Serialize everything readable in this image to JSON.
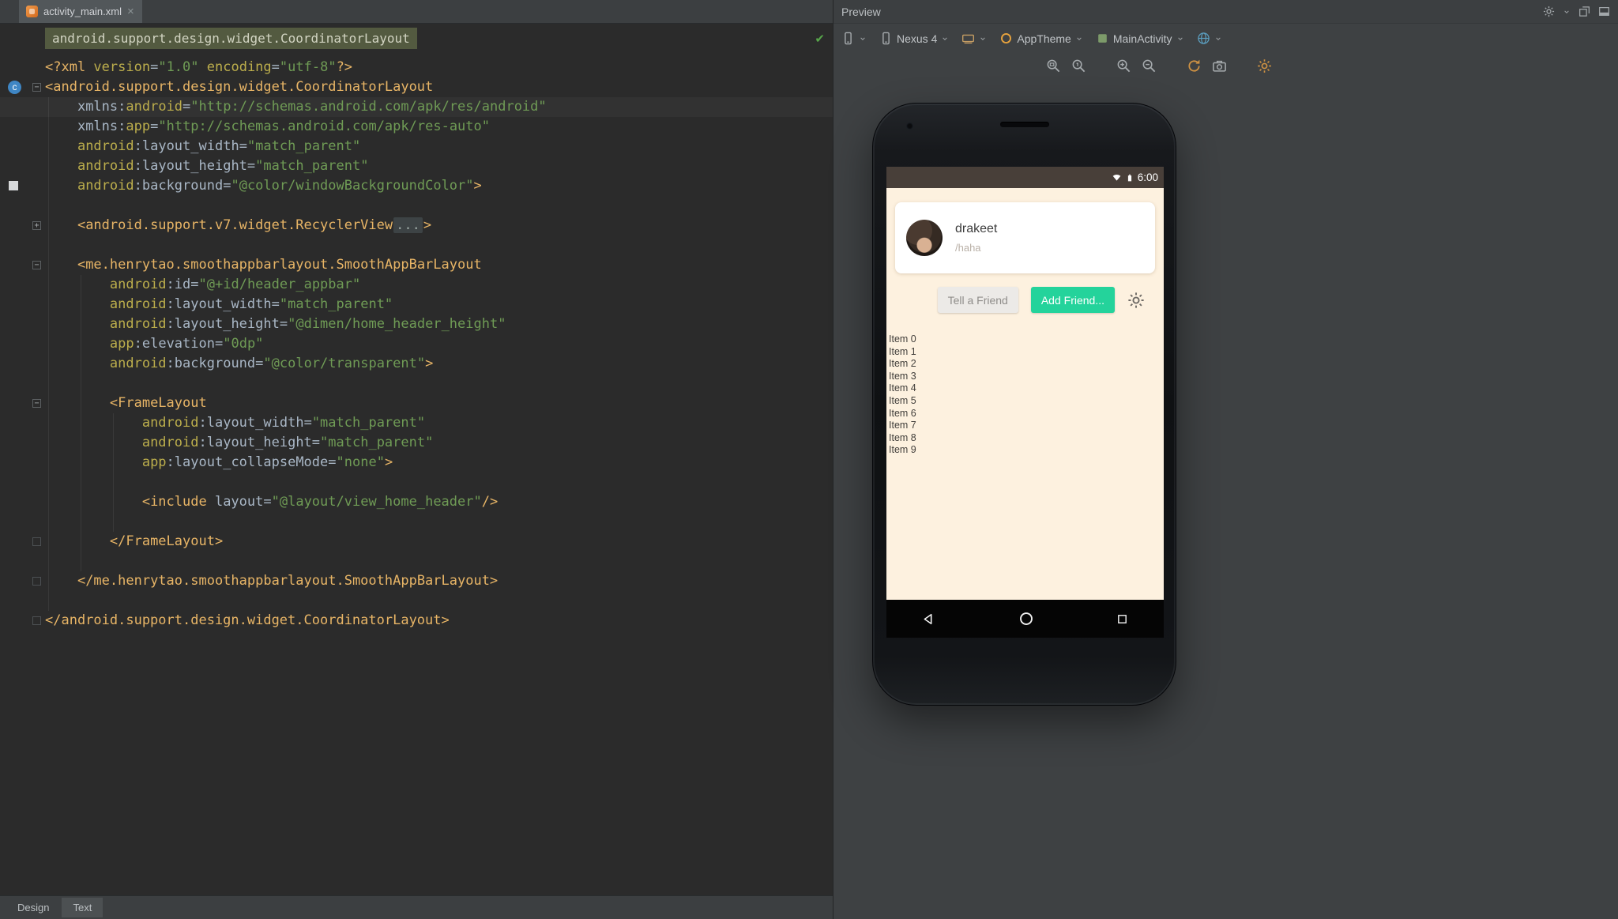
{
  "editor": {
    "tab_label": "activity_main.xml",
    "breadcrumb": "android.support.design.widget.CoordinatorLayout",
    "bottom_tabs": [
      {
        "label": "Design",
        "selected": false
      },
      {
        "label": "Text",
        "selected": true
      }
    ],
    "code_lines": [
      {
        "t": [
          [
            "g",
            "<?xml "
          ],
          [
            "a",
            "version"
          ],
          [
            "p",
            "="
          ],
          [
            "v",
            "\"1.0\""
          ],
          [
            "p",
            " "
          ],
          [
            "a",
            "encoding"
          ],
          [
            "p",
            "="
          ],
          [
            "v",
            "\"utf-8\""
          ],
          [
            "g",
            "?>"
          ]
        ]
      },
      {
        "g": "minus",
        "b": "class",
        "t": [
          [
            "g",
            "<android.support.design.widget.CoordinatorLayout"
          ]
        ]
      },
      {
        "hl": true,
        "t": [
          [
            "p",
            "    "
          ],
          [
            "n",
            "xmlns"
          ],
          [
            "p",
            ":"
          ],
          [
            "a",
            "android"
          ],
          [
            "p",
            "="
          ],
          [
            "v",
            "\"http://schemas.android.com/apk/res/android\""
          ]
        ]
      },
      {
        "t": [
          [
            "p",
            "    "
          ],
          [
            "n",
            "xmlns"
          ],
          [
            "p",
            ":"
          ],
          [
            "a",
            "app"
          ],
          [
            "p",
            "="
          ],
          [
            "v",
            "\"http://schemas.android.com/apk/res-auto\""
          ]
        ]
      },
      {
        "t": [
          [
            "p",
            "    "
          ],
          [
            "a",
            "android"
          ],
          [
            "p",
            ":"
          ],
          [
            "n",
            "layout_width"
          ],
          [
            "p",
            "="
          ],
          [
            "v",
            "\"match_parent\""
          ]
        ]
      },
      {
        "t": [
          [
            "p",
            "    "
          ],
          [
            "a",
            "android"
          ],
          [
            "p",
            ":"
          ],
          [
            "n",
            "layout_height"
          ],
          [
            "p",
            "="
          ],
          [
            "v",
            "\"match_parent\""
          ]
        ]
      },
      {
        "b": "bookmark",
        "t": [
          [
            "p",
            "    "
          ],
          [
            "a",
            "android"
          ],
          [
            "p",
            ":"
          ],
          [
            "n",
            "background"
          ],
          [
            "p",
            "="
          ],
          [
            "v",
            "\"@color/windowBackgroundColor\""
          ],
          [
            "g",
            ">"
          ]
        ]
      },
      {
        "t": []
      },
      {
        "g": "plus",
        "t": [
          [
            "p",
            "    "
          ],
          [
            "g",
            "<android.support.v7.widget.RecyclerView"
          ],
          [
            "f",
            "..."
          ],
          [
            "g",
            ">"
          ]
        ]
      },
      {
        "t": []
      },
      {
        "g": "minus",
        "t": [
          [
            "p",
            "    "
          ],
          [
            "g",
            "<me.henrytao.smoothappbarlayout.SmoothAppBarLayout"
          ]
        ]
      },
      {
        "t": [
          [
            "p",
            "        "
          ],
          [
            "a",
            "android"
          ],
          [
            "p",
            ":"
          ],
          [
            "n",
            "id"
          ],
          [
            "p",
            "="
          ],
          [
            "v",
            "\"@+id/header_appbar\""
          ]
        ]
      },
      {
        "t": [
          [
            "p",
            "        "
          ],
          [
            "a",
            "android"
          ],
          [
            "p",
            ":"
          ],
          [
            "n",
            "layout_width"
          ],
          [
            "p",
            "="
          ],
          [
            "v",
            "\"match_parent\""
          ]
        ]
      },
      {
        "t": [
          [
            "p",
            "        "
          ],
          [
            "a",
            "android"
          ],
          [
            "p",
            ":"
          ],
          [
            "n",
            "layout_height"
          ],
          [
            "p",
            "="
          ],
          [
            "v",
            "\"@dimen/home_header_height\""
          ]
        ]
      },
      {
        "t": [
          [
            "p",
            "        "
          ],
          [
            "a",
            "app"
          ],
          [
            "p",
            ":"
          ],
          [
            "n",
            "elevation"
          ],
          [
            "p",
            "="
          ],
          [
            "v",
            "\"0dp\""
          ]
        ]
      },
      {
        "t": [
          [
            "p",
            "        "
          ],
          [
            "a",
            "android"
          ],
          [
            "p",
            ":"
          ],
          [
            "n",
            "background"
          ],
          [
            "p",
            "="
          ],
          [
            "v",
            "\"@color/transparent\""
          ],
          [
            "g",
            ">"
          ]
        ]
      },
      {
        "t": []
      },
      {
        "g": "minus",
        "t": [
          [
            "p",
            "        "
          ],
          [
            "g",
            "<FrameLayout"
          ]
        ]
      },
      {
        "t": [
          [
            "p",
            "            "
          ],
          [
            "a",
            "android"
          ],
          [
            "p",
            ":"
          ],
          [
            "n",
            "layout_width"
          ],
          [
            "p",
            "="
          ],
          [
            "v",
            "\"match_parent\""
          ]
        ]
      },
      {
        "t": [
          [
            "p",
            "            "
          ],
          [
            "a",
            "android"
          ],
          [
            "p",
            ":"
          ],
          [
            "n",
            "layout_height"
          ],
          [
            "p",
            "="
          ],
          [
            "v",
            "\"match_parent\""
          ]
        ]
      },
      {
        "t": [
          [
            "p",
            "            "
          ],
          [
            "a",
            "app"
          ],
          [
            "p",
            ":"
          ],
          [
            "n",
            "layout_collapseMode"
          ],
          [
            "p",
            "="
          ],
          [
            "v",
            "\"none\""
          ],
          [
            "g",
            ">"
          ]
        ]
      },
      {
        "t": []
      },
      {
        "t": [
          [
            "p",
            "            "
          ],
          [
            "g",
            "<include "
          ],
          [
            "n",
            "layout"
          ],
          [
            "p",
            "="
          ],
          [
            "v",
            "\"@layout/view_home_header\""
          ],
          [
            "g",
            "/>"
          ]
        ]
      },
      {
        "t": []
      },
      {
        "g": "end",
        "t": [
          [
            "p",
            "        "
          ],
          [
            "g",
            "</FrameLayout>"
          ]
        ]
      },
      {
        "t": []
      },
      {
        "g": "end",
        "t": [
          [
            "p",
            "    "
          ],
          [
            "g",
            "</me.henrytao.smoothappbarlayout.SmoothAppBarLayout>"
          ]
        ]
      },
      {
        "t": []
      },
      {
        "g": "end",
        "t": [
          [
            "g",
            "</android.support.design.widget.CoordinatorLayout>"
          ]
        ]
      }
    ]
  },
  "preview": {
    "title": "Preview",
    "toolbar": {
      "device_label": "Nexus 4",
      "theme_label": "AppTheme",
      "activity_label": "MainActivity"
    },
    "phone": {
      "status_time": "6:00",
      "card": {
        "name": "drakeet",
        "subtitle": "/haha"
      },
      "buttons": [
        {
          "label": "Tell a Friend"
        },
        {
          "label": "Add Friend..."
        }
      ],
      "list_items": [
        "Item 0",
        "Item 1",
        "Item 2",
        "Item 3",
        "Item 4",
        "Item 5",
        "Item 6",
        "Item 7",
        "Item 8",
        "Item 9"
      ]
    }
  },
  "icons": {
    "close": "×",
    "check": "✔",
    "class_badge": "c",
    "fold_plus": "+",
    "fold_minus": "−",
    "names": [
      "xml-file-icon",
      "close-tab-icon",
      "inspection-check-icon",
      "class-icon",
      "bookmark-icon",
      "fold-marker",
      "device-config-icon",
      "phone-icon",
      "orientation-icon",
      "theme-icon",
      "activity-icon",
      "globe-icon",
      "chevron-down-icon",
      "gear-icon",
      "float-icon",
      "hide-icon",
      "zoom-fit-icon",
      "zoom-actual-icon",
      "zoom-in-icon",
      "zoom-out-icon",
      "refresh-icon",
      "camera-icon",
      "render-settings-icon",
      "wifi-icon",
      "battery-icon",
      "settings-gear-icon",
      "back-icon",
      "home-icon",
      "recents-icon",
      "avatar",
      "speaker-slot",
      "front-camera"
    ]
  },
  "colors": {
    "editor_bg": "#2b2b2b",
    "panel_bg": "#3c3f41",
    "canvas_bg": "#3e4143",
    "tag": "#e8b566",
    "namespace": "#bcae4c",
    "attr_name": "#a9b7c6",
    "string": "#6f9b55",
    "breadcrumb_bg": "#535a40",
    "current_line": "#323232",
    "check_green": "#57a64a",
    "app_bg": "#fdf1df",
    "statusbar": "#483f39",
    "add_friend_green": "#24d39b",
    "tell_friend_gray": "#eceae7",
    "card_bg": "#ffffff"
  }
}
